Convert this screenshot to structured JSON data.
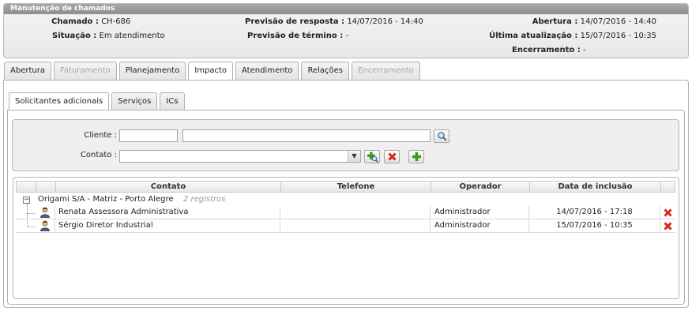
{
  "panel": {
    "title": "Manutenção de chamados",
    "chamado_label": "Chamado :",
    "chamado_value": "CH-686",
    "situacao_label": "Situação :",
    "situacao_value": "Em atendimento",
    "prev_resposta_label": "Previsão de resposta :",
    "prev_resposta_value": "14/07/2016 - 14:40",
    "prev_termino_label": "Previsão de término :",
    "prev_termino_value": "-",
    "abertura_label": "Abertura :",
    "abertura_value": "14/07/2016 - 14:40",
    "ultima_label": "Última atualização :",
    "ultima_value": "15/07/2016 - 10:35",
    "encerramento_label": "Encerramento :",
    "encerramento_value": "-"
  },
  "tabs": [
    {
      "label": "Abertura",
      "state": "normal"
    },
    {
      "label": "Faturamento",
      "state": "disabled"
    },
    {
      "label": "Planejamento",
      "state": "normal"
    },
    {
      "label": "Impacto",
      "state": "active"
    },
    {
      "label": "Atendimento",
      "state": "normal"
    },
    {
      "label": "Relações",
      "state": "normal"
    },
    {
      "label": "Encerramento",
      "state": "disabled"
    }
  ],
  "subtabs": [
    {
      "label": "Solicitantes adicionais",
      "state": "active"
    },
    {
      "label": "Serviços",
      "state": "normal"
    },
    {
      "label": "ICs",
      "state": "normal"
    }
  ],
  "filter": {
    "cliente_label": "Cliente :",
    "cliente_code": "",
    "cliente_name": "",
    "contato_label": "Contato :",
    "contato_value": ""
  },
  "grid": {
    "columns": [
      "Contato",
      "Telefone",
      "Operador",
      "Data de inclusão"
    ],
    "group": {
      "name": "Origami S/A - Matriz - Porto Alegre",
      "count": "2 registros"
    },
    "rows": [
      {
        "contato": "Renata Assessora Administrativa",
        "telefone": "",
        "operador": "Administrador",
        "data": "14/07/2016 - 17:18"
      },
      {
        "contato": "Sérgio Diretor Industrial",
        "telefone": "",
        "operador": "Administrador",
        "data": "15/07/2016 - 10:35"
      }
    ]
  },
  "colors": {
    "delete_red": "#d9261c",
    "add_green": "#3a9a1e",
    "header_gray": "#999999"
  }
}
